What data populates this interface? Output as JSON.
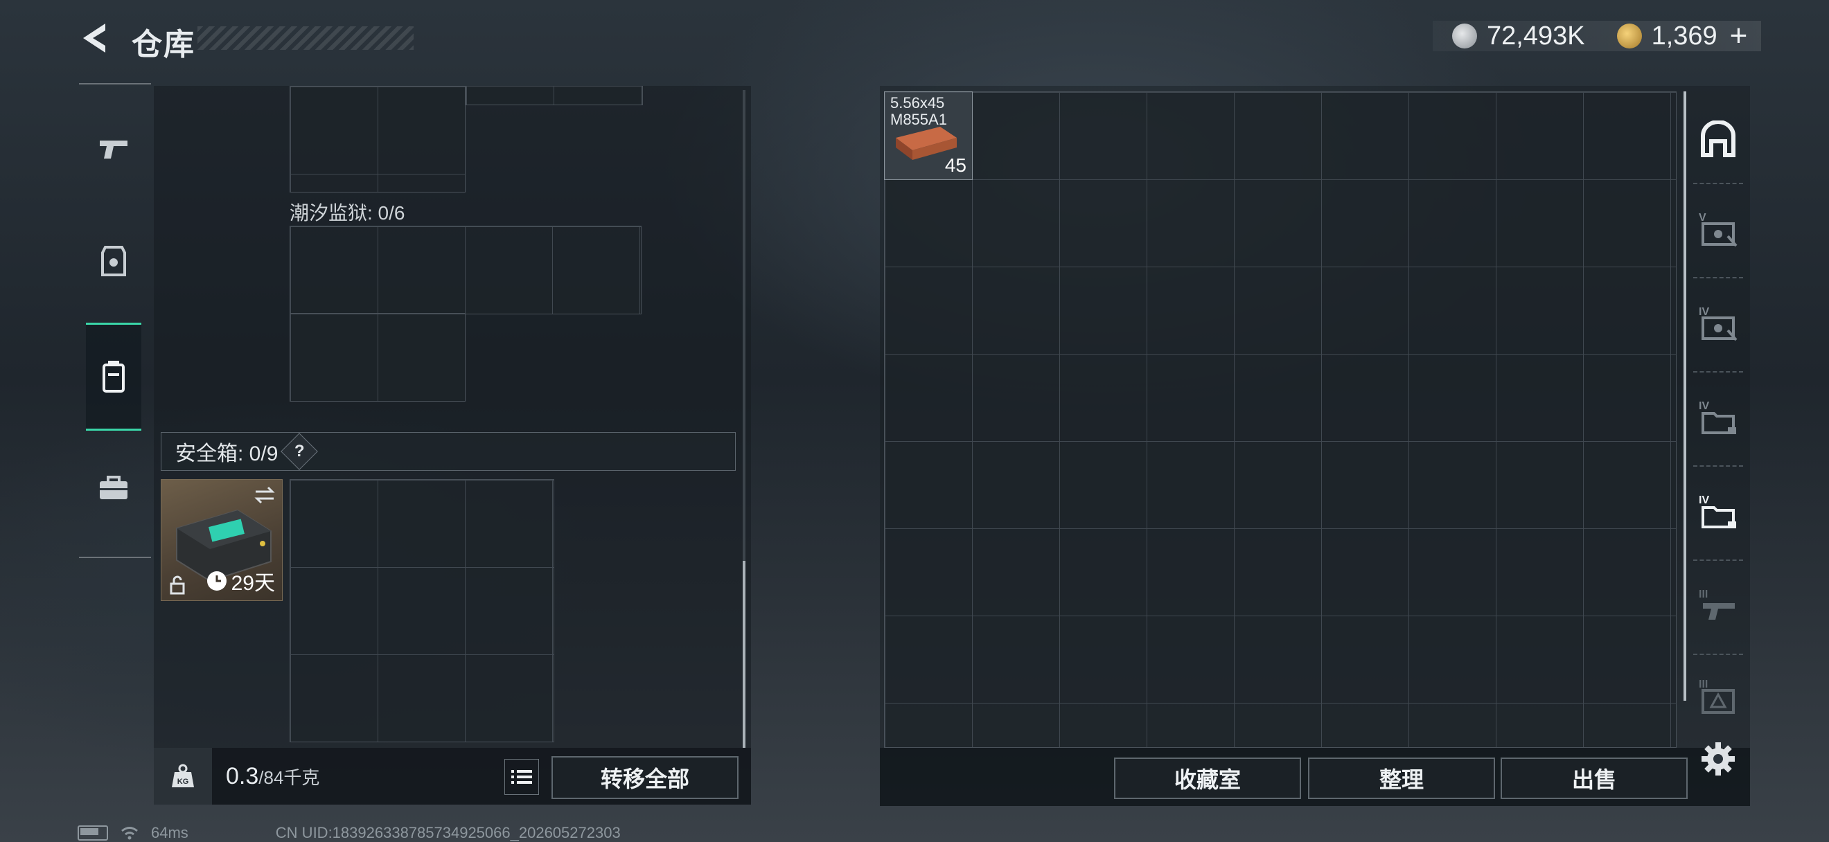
{
  "header": {
    "title": "仓库",
    "silver_amount": "72,493K",
    "gold_amount": "1,369",
    "add_label": "+"
  },
  "left": {
    "section_label": "潮汐监狱: 0/6",
    "safe_box_label": "安全箱: 0/9",
    "help_label": "?",
    "safe_box_days": "29天",
    "weight_current": "0.3",
    "weight_max": "/84千克",
    "weight_icon_text": "KG",
    "transfer_all_label": "转移全部"
  },
  "stash": {
    "item": {
      "name_line1": "5.56x45",
      "name_line2": "M855A1",
      "count": "45"
    },
    "collection_label": "收藏室",
    "organize_label": "整理",
    "sell_label": "出售"
  },
  "tabs": [
    {
      "icon": "arch-icon"
    },
    {
      "icon": "tier-v-case-icon",
      "tier": "V"
    },
    {
      "icon": "tier-iv-case-icon",
      "tier": "IV"
    },
    {
      "icon": "tier-iv-folder-icon",
      "tier": "IV"
    },
    {
      "icon": "tier-iv-folder-active-icon",
      "tier": "IV"
    },
    {
      "icon": "tier-iii-gun-icon",
      "tier": "III"
    },
    {
      "icon": "tier-iii-box-icon",
      "tier": "III"
    }
  ],
  "status_bar": {
    "ping": "64ms",
    "uid": "CN UID:183926338785734925066_202605272303"
  },
  "colors": {
    "accent": "#3ad6a8"
  }
}
